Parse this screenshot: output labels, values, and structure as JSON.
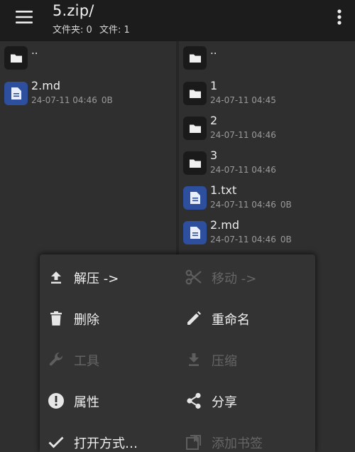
{
  "header": {
    "title": "5.zip/",
    "folders_label": "文件夹: 0",
    "files_label": "文件: 1",
    "menu_icon": "hamburger-menu-icon",
    "more_icon": "more-vertical-icon"
  },
  "left_pane": {
    "items": [
      {
        "name": "..",
        "type": "folder",
        "meta": "",
        "size": ""
      },
      {
        "name": "2.md",
        "type": "file",
        "meta": "24-07-11 04:46",
        "size": "0B"
      }
    ]
  },
  "right_pane": {
    "items": [
      {
        "name": "..",
        "type": "folder",
        "meta": "",
        "size": ""
      },
      {
        "name": "1",
        "type": "folder",
        "meta": "24-07-11 04:45",
        "size": ""
      },
      {
        "name": "2",
        "type": "folder",
        "meta": "24-07-11 04:46",
        "size": ""
      },
      {
        "name": "3",
        "type": "folder",
        "meta": "24-07-11 04:46",
        "size": ""
      },
      {
        "name": "1.txt",
        "type": "file",
        "meta": "24-07-11 04:46",
        "size": "0B"
      },
      {
        "name": "2.md",
        "type": "file",
        "meta": "24-07-11 04:46",
        "size": "0B"
      }
    ]
  },
  "actions": {
    "extract": {
      "label": "解压 ->",
      "icon": "upload-arrow-icon",
      "enabled": true
    },
    "move": {
      "label": "移动 ->",
      "icon": "scissors-icon",
      "enabled": false
    },
    "delete": {
      "label": "删除",
      "icon": "trash-icon",
      "enabled": true
    },
    "rename": {
      "label": "重命名",
      "icon": "pencil-icon",
      "enabled": true
    },
    "tools": {
      "label": "工具",
      "icon": "wrench-icon",
      "enabled": false
    },
    "compress": {
      "label": "压缩",
      "icon": "download-arrow-icon",
      "enabled": false
    },
    "properties": {
      "label": "属性",
      "icon": "info-icon",
      "enabled": true
    },
    "share": {
      "label": "分享",
      "icon": "share-icon",
      "enabled": true
    },
    "open_with": {
      "label": "打开方式…",
      "icon": "check-icon",
      "enabled": true
    },
    "bookmark": {
      "label": "添加书签",
      "icon": "bookmark-icon",
      "enabled": false
    }
  },
  "colors": {
    "appbar": "#1c1c1c",
    "background": "#2f2f2f",
    "file_icon_bg": "#2d4f9e",
    "folder_icon_bg": "#1a1a1a",
    "sheet": "#333333",
    "disabled": "#666666"
  }
}
